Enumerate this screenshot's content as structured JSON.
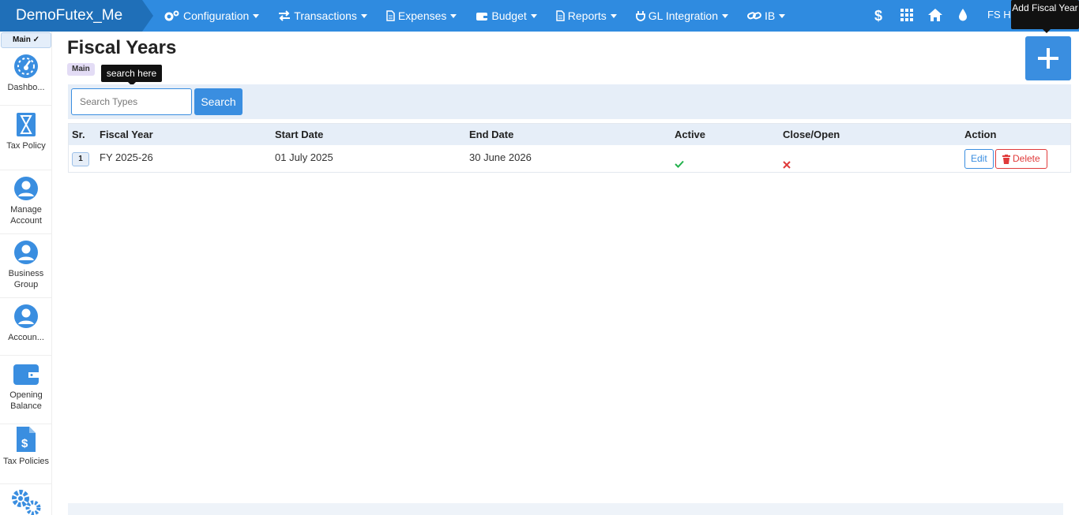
{
  "navbar": {
    "brand": "DemoFutex_Me",
    "menu": [
      {
        "label": "Configuration",
        "icon": "gears-icon"
      },
      {
        "label": "Transactions",
        "icon": "exchange-icon"
      },
      {
        "label": "Expenses",
        "icon": "document-icon"
      },
      {
        "label": "Budget",
        "icon": "wallet-icon"
      },
      {
        "label": "Reports",
        "icon": "document-icon"
      },
      {
        "label": "GL Integration",
        "icon": "plug-icon"
      },
      {
        "label": "IB",
        "icon": "link-icon"
      }
    ],
    "right_icons": [
      "dollar-icon",
      "grid-icon",
      "home-icon",
      "drop-icon"
    ],
    "user_name": "FS Ha"
  },
  "sidebar": {
    "main_tag": "Main ✓",
    "items": [
      {
        "label": "Dashbo...",
        "icon": "dashboard-gauge-icon"
      },
      {
        "label": "Tax Policy",
        "icon": "hourglass-icon"
      },
      {
        "label": "Manage Account",
        "icon": "user-circle-icon"
      },
      {
        "label": "Business Group",
        "icon": "user-circle-icon"
      },
      {
        "label": "Accoun...",
        "icon": "user-circle-icon"
      },
      {
        "label": "Opening Balance",
        "icon": "wallet-icon"
      },
      {
        "label": "Tax Policies",
        "icon": "dollar-file-icon"
      },
      {
        "label": "",
        "icon": "gears-icon"
      }
    ]
  },
  "page": {
    "title": "Fiscal Years",
    "breadcrumb": "Main",
    "search_tooltip": "search here",
    "add_tooltip": "Add Fiscal Year",
    "colors": {
      "primary": "#3a8ee0",
      "navbar": "#2f8be0",
      "brand": "#1f6fb8",
      "danger": "#e03a3a",
      "success": "#22b14c"
    }
  },
  "search": {
    "placeholder": "Search Types",
    "value": "",
    "button_label": "Search"
  },
  "table": {
    "headers": [
      "Sr.",
      "Fiscal Year",
      "Start Date",
      "End Date",
      "Active",
      "Close/Open",
      "Action"
    ],
    "rows": [
      {
        "sr": "1",
        "fiscal_year": "FY 2025-26",
        "start_date": "01 July 2025",
        "end_date": "30 June 2026",
        "active": "check-icon",
        "close_open": "cross-icon",
        "edit_label": "Edit",
        "delete_label": "Delete"
      }
    ]
  }
}
